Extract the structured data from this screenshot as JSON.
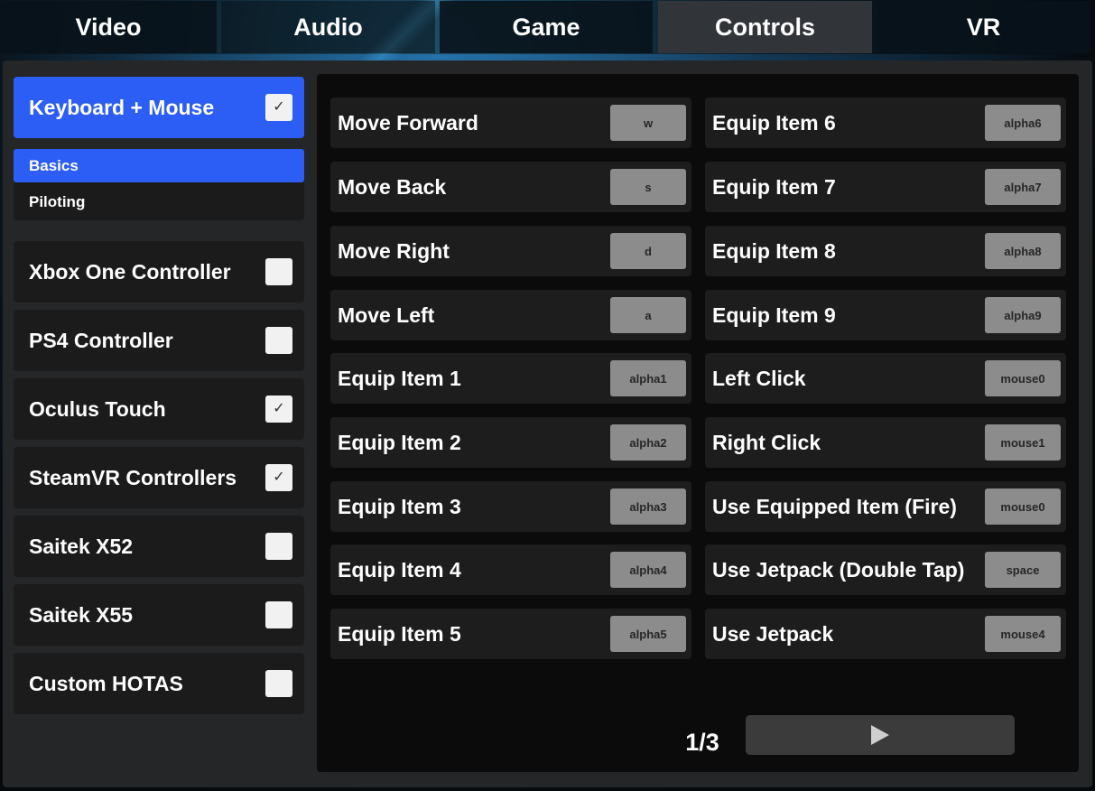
{
  "tabs": [
    {
      "label": "Video",
      "active": false
    },
    {
      "label": "Audio",
      "active": false
    },
    {
      "label": "Game",
      "active": false
    },
    {
      "label": "Controls",
      "active": true
    },
    {
      "label": "VR",
      "active": false
    }
  ],
  "devices": [
    {
      "label": "Keyboard + Mouse",
      "checked": true,
      "selected": true
    },
    {
      "label": "Xbox One Controller",
      "checked": false,
      "selected": false
    },
    {
      "label": "PS4 Controller",
      "checked": false,
      "selected": false
    },
    {
      "label": "Oculus Touch",
      "checked": true,
      "selected": false
    },
    {
      "label": "SteamVR Controllers",
      "checked": true,
      "selected": false
    },
    {
      "label": "Saitek X52",
      "checked": false,
      "selected": false
    },
    {
      "label": "Saitek X55",
      "checked": false,
      "selected": false
    },
    {
      "label": "Custom HOTAS",
      "checked": false,
      "selected": false
    }
  ],
  "categories": [
    {
      "label": "Basics",
      "active": true
    },
    {
      "label": "Piloting",
      "active": false
    }
  ],
  "bindings": {
    "left": [
      {
        "action": "Move Forward",
        "key": "w"
      },
      {
        "action": "Move Back",
        "key": "s"
      },
      {
        "action": "Move Right",
        "key": "d"
      },
      {
        "action": "Move Left",
        "key": "a"
      },
      {
        "action": "Equip Item 1",
        "key": "alpha1"
      },
      {
        "action": "Equip Item 2",
        "key": "alpha2"
      },
      {
        "action": "Equip Item 3",
        "key": "alpha3"
      },
      {
        "action": "Equip Item 4",
        "key": "alpha4"
      },
      {
        "action": "Equip Item 5",
        "key": "alpha5"
      }
    ],
    "right": [
      {
        "action": "Equip Item 6",
        "key": "alpha6"
      },
      {
        "action": "Equip Item 7",
        "key": "alpha7"
      },
      {
        "action": "Equip Item 8",
        "key": "alpha8"
      },
      {
        "action": "Equip Item 9",
        "key": "alpha9"
      },
      {
        "action": "Left Click",
        "key": "mouse0"
      },
      {
        "action": "Right Click",
        "key": "mouse1"
      },
      {
        "action": "Use Equipped Item (Fire)",
        "key": "mouse0"
      },
      {
        "action": "Use Jetpack (Double Tap)",
        "key": "space"
      },
      {
        "action": "Use Jetpack",
        "key": "mouse4"
      }
    ]
  },
  "pagination": {
    "label": "1/3",
    "next_icon": "play-triangle-icon"
  },
  "icons": {
    "check": "✓"
  },
  "colors": {
    "accent": "#2c5ef5",
    "key_bg": "#8c8c8c"
  }
}
